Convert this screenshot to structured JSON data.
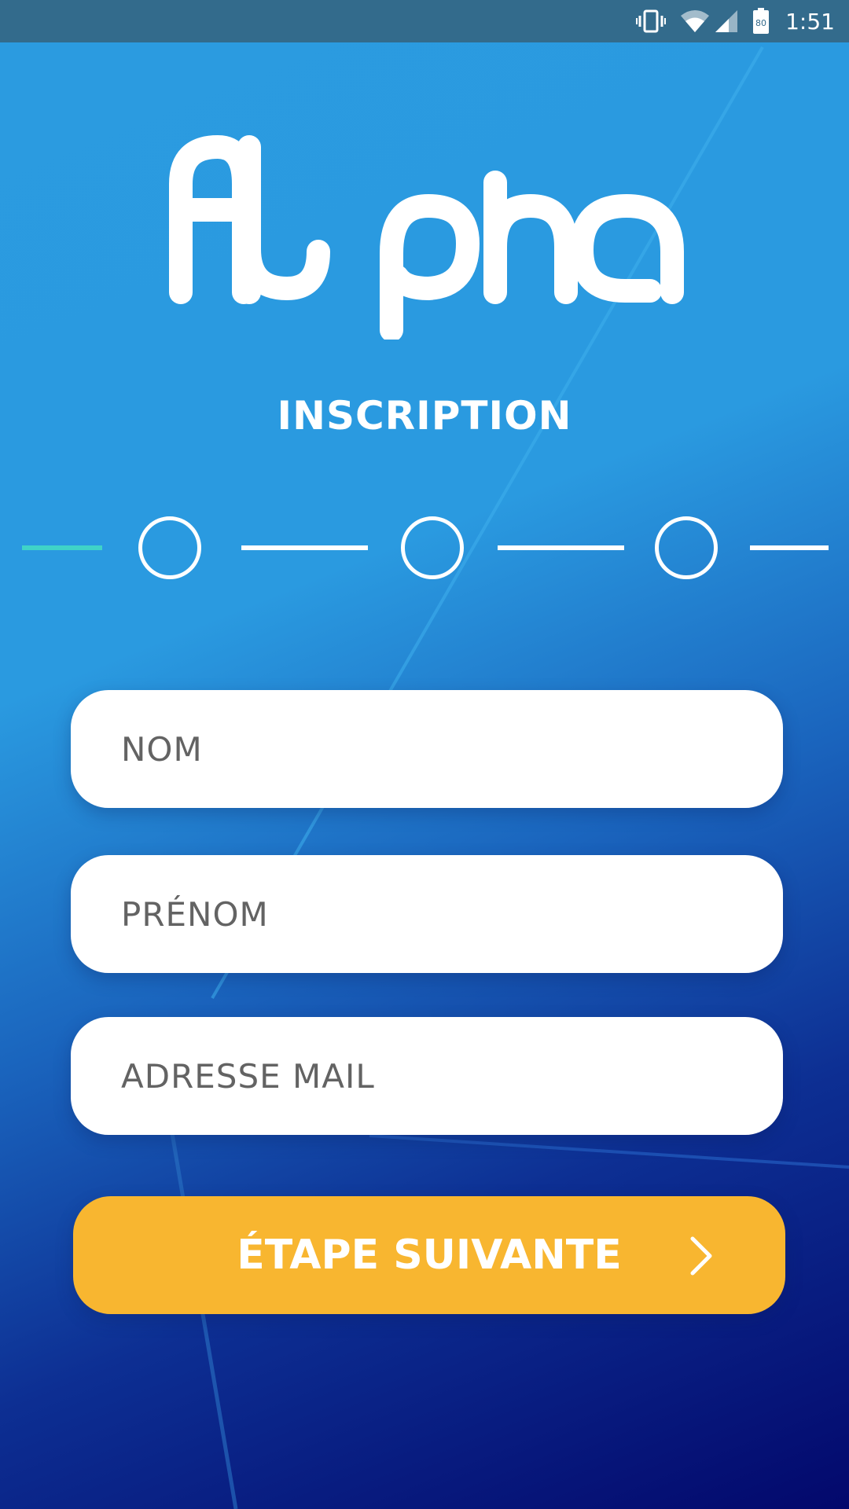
{
  "status_bar": {
    "time": "1:51",
    "battery_level": "80",
    "icons": [
      "vibrate-icon",
      "wifi-icon",
      "cell-signal-icon",
      "battery-icon"
    ]
  },
  "logo": {
    "text": "Alpha"
  },
  "page": {
    "title": "INSCRIPTION"
  },
  "stepper": {
    "total_steps": 3,
    "current_step": 1
  },
  "form": {
    "nom_placeholder": "NOM",
    "prenom_placeholder": "PRÉNOM",
    "email_placeholder": "ADRESSE MAIL"
  },
  "next_button": {
    "label": "ÉTAPE SUIVANTE",
    "icon": "chevron-right-icon"
  },
  "colors": {
    "accent": "#f8b630",
    "active_step": "#3fd3c8",
    "gradient_top": "#2b9be0",
    "gradient_bottom": "#03086c"
  }
}
